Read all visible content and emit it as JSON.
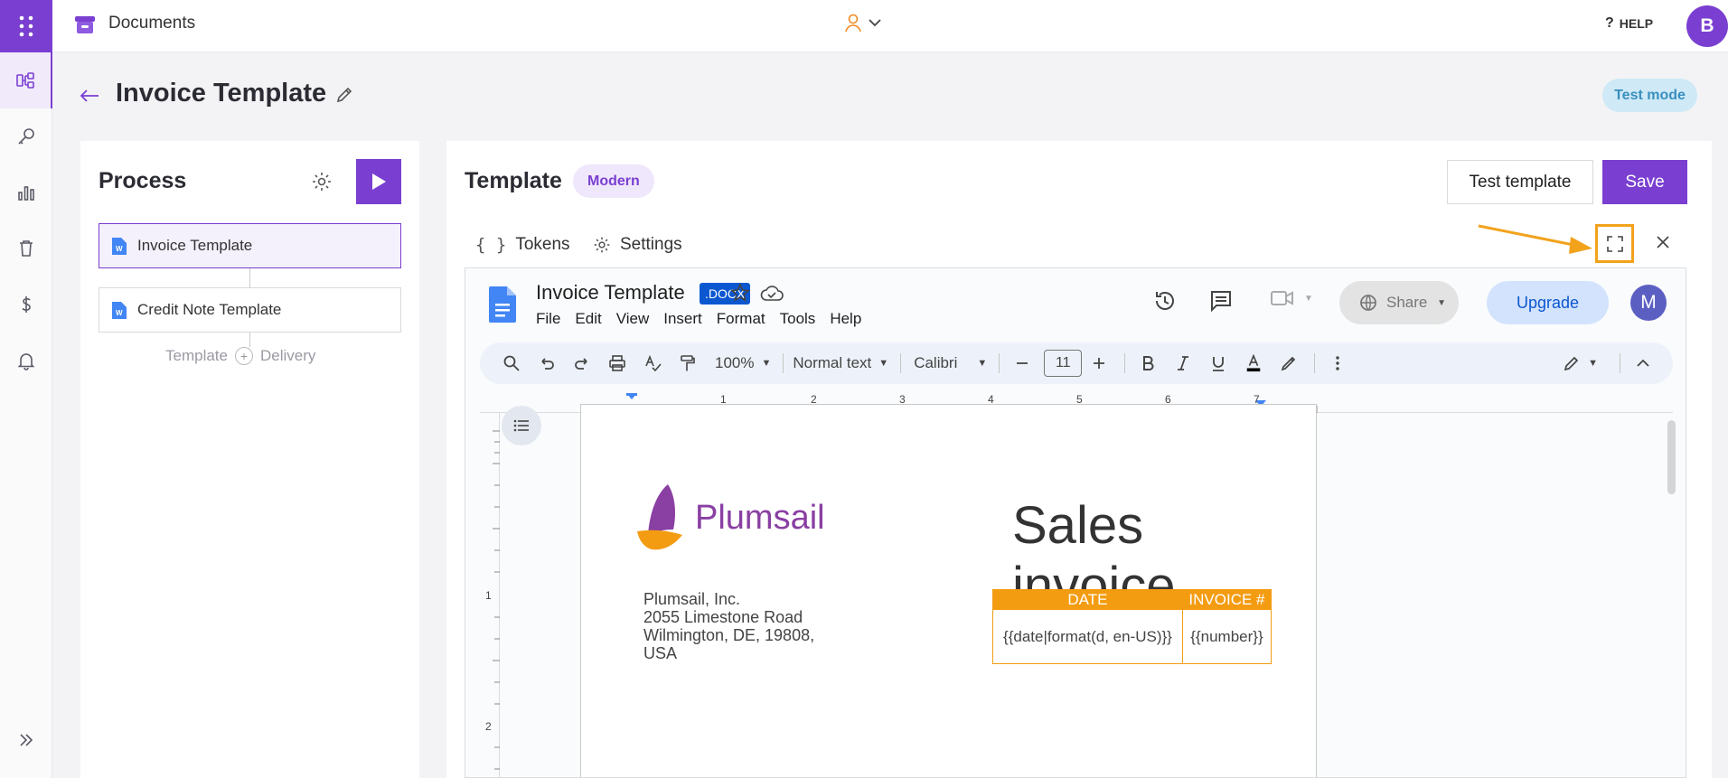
{
  "app": {
    "title": "Documents"
  },
  "header": {
    "page_title": "Invoice Template",
    "test_mode": "Test mode",
    "help": "HELP",
    "user_initial": "B"
  },
  "process": {
    "title": "Process",
    "items": [
      "Invoice Template",
      "Credit Note Template"
    ],
    "footer_left": "Template",
    "footer_right": "Delivery"
  },
  "template": {
    "title": "Template",
    "badge": "Modern",
    "test_button": "Test template",
    "save_button": "Save",
    "tabs": [
      "Tokens",
      "Settings"
    ]
  },
  "gdoc": {
    "doc_name": "Invoice Template",
    "format_badge": ".DOCX",
    "menu": [
      "File",
      "Edit",
      "View",
      "Insert",
      "Format",
      "Tools",
      "Help"
    ],
    "share": "Share",
    "upgrade": "Upgrade",
    "avatar": "M",
    "zoom": "100%",
    "style": "Normal text",
    "font": "Calibri",
    "font_size": "11",
    "ruler": [
      "1",
      "2",
      "3",
      "4",
      "5",
      "6",
      "7"
    ],
    "vruler": [
      "1",
      "2"
    ]
  },
  "document": {
    "logo_text": "Plumsail",
    "heading": "Sales invoice",
    "address": [
      "Plumsail, Inc.",
      "2055 Limestone Road",
      "Wilmington, DE, 19808,",
      "USA"
    ],
    "table": {
      "headers": [
        "DATE",
        "INVOICE #"
      ],
      "row": [
        "{{date|format(d, en-US)}}",
        "{{number}}"
      ]
    }
  },
  "colors": {
    "accent": "#7a3fd1",
    "highlight": "#f2a21b",
    "table": "#f39c12"
  }
}
